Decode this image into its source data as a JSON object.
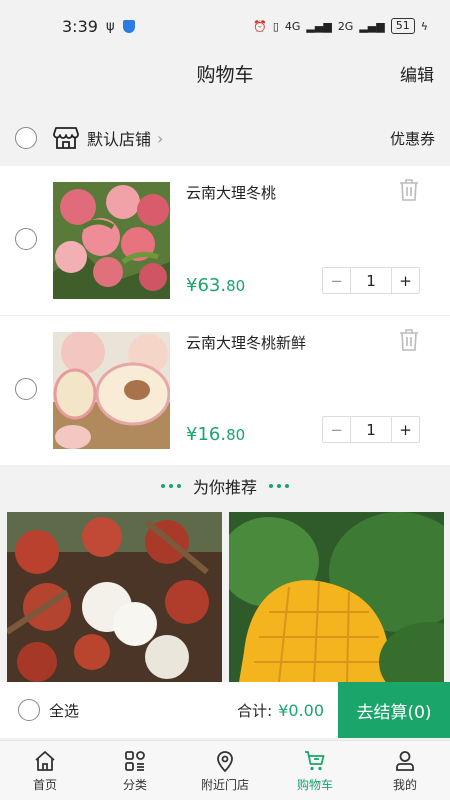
{
  "status": {
    "time": "3:39",
    "net1": "4G",
    "net2": "2G",
    "battery": "51"
  },
  "header": {
    "title": "购物车",
    "edit_label": "编辑"
  },
  "store": {
    "name": "默认店铺",
    "coupon_label": "优惠券"
  },
  "items": [
    {
      "name": "云南大理冬桃",
      "price_main": "¥63.",
      "price_dec": "80",
      "qty": "1",
      "minus": "−",
      "plus": "+"
    },
    {
      "name": "云南大理冬桃新鲜",
      "price_main": "¥16.",
      "price_dec": "80",
      "qty": "1",
      "minus": "−",
      "plus": "+"
    }
  ],
  "recommend": {
    "title": "为你推荐"
  },
  "checkout": {
    "select_all": "全选",
    "total_label": "合计:",
    "total_value": "¥0.00",
    "pay_label": "去结算(0)"
  },
  "tabs": [
    {
      "label": "首页",
      "icon": "home-icon"
    },
    {
      "label": "分类",
      "icon": "category-icon"
    },
    {
      "label": "附近门店",
      "icon": "location-icon"
    },
    {
      "label": "购物车",
      "icon": "cart-icon",
      "active": true
    },
    {
      "label": "我的",
      "icon": "user-icon"
    }
  ],
  "colors": {
    "accent": "#1aa56a",
    "background": "#f2f2f2"
  }
}
